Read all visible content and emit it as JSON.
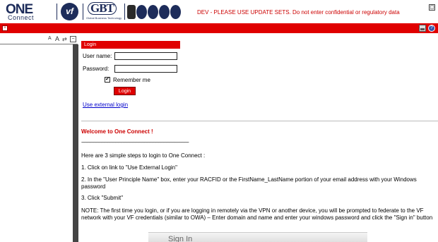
{
  "banner": {
    "logo_one": "ONE",
    "logo_connect": "Connect",
    "logo_vf": "vf",
    "logo_gbt": "GBT",
    "logo_gbt_sub": "Global Business Technology",
    "dev_message": "DEV - PLEASE USE UPDATE SETS. Do not enter confidential or regulatory data",
    "corner_button": "▢"
  },
  "toolbar": {
    "collapse_button": "+",
    "help_icon": "?"
  },
  "nav": {
    "font_small": "A",
    "font_large": "A",
    "font_swap": "⇄",
    "close": "−"
  },
  "login": {
    "header": "Login",
    "username_label": "User name:",
    "password_label": "Password:",
    "remember_check": "✔",
    "remember_label": "Remember me",
    "button_label": "Login",
    "external_link": "Use external login"
  },
  "welcome": {
    "title": "Welcome to One Connect !",
    "dashes": "------------------------------------------------------------------------------------------------------------------",
    "p1": "Here are 3 simple steps to login to One Connect :",
    "p2": "1. Click on link to \"Use External Login\"",
    "p3": "2. In the \"User Principle Name\" box, enter your RACFID or the FirstName_LastName portion of your email address with your Windows password",
    "p4": "3. Click \"Submit\"",
    "p5": "NOTE: The first time you login, or if you are logging in remotely via the VPN or another device, you will be prompted to federate to the VF network with your VF credentials (similar to OWA) – Enter domain and name and enter your windows password and click the \"Sign in\" button"
  },
  "signin_button": "Sign In",
  "colors": {
    "brand_red": "#e00000",
    "brand_navy": "#1d2c5a",
    "link_blue": "#0000cc"
  }
}
